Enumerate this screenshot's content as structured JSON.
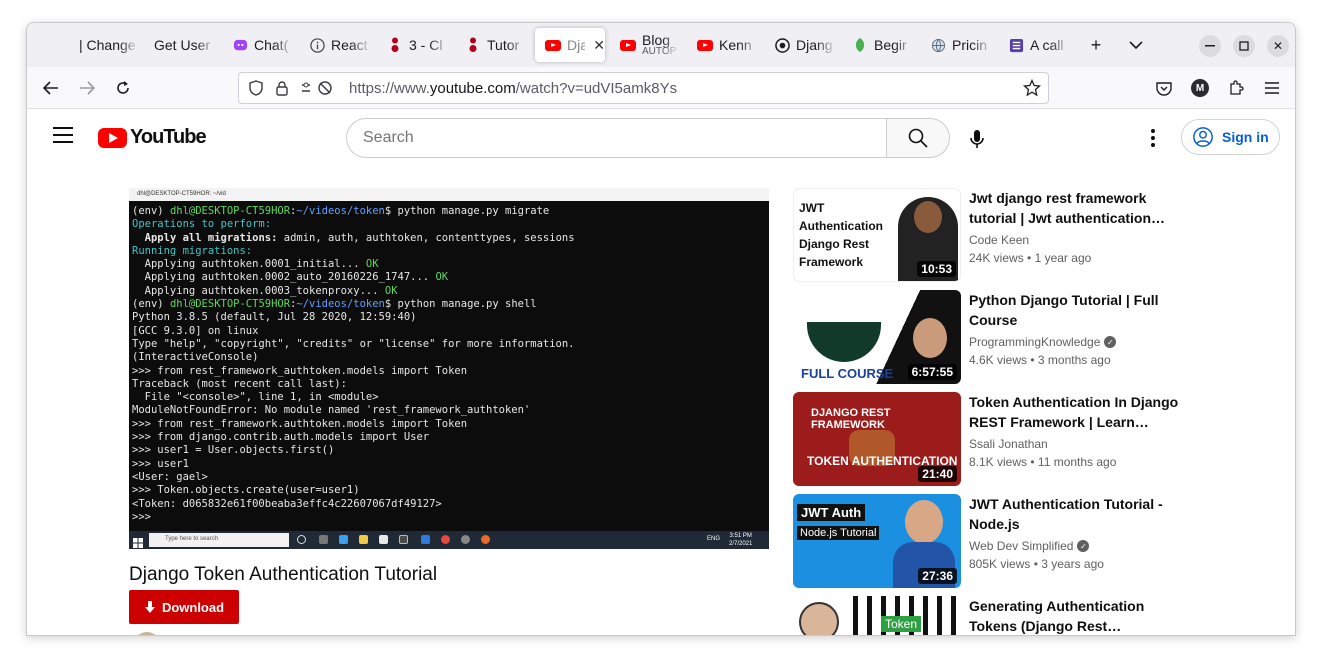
{
  "browser": {
    "tabs": [
      {
        "label": "| Change",
        "favicon": "none"
      },
      {
        "label": "Get User",
        "favicon": "none"
      },
      {
        "label": "Chat(",
        "favicon": "chat-icon"
      },
      {
        "label": "React",
        "favicon": "info-icon"
      },
      {
        "label": "3 - Cl",
        "favicon": "dots-icon"
      },
      {
        "label": "Tutor",
        "favicon": "dots-icon"
      },
      {
        "label": "Dja",
        "favicon": "youtube-icon",
        "active": true
      },
      {
        "label": "Blog",
        "sub": "AUTOP",
        "favicon": "youtube-icon"
      },
      {
        "label": "Kenn",
        "favicon": "youtube-icon"
      },
      {
        "label": "Djang",
        "favicon": "github-icon"
      },
      {
        "label": "Begir",
        "favicon": "leaf-icon"
      },
      {
        "label": "Pricin",
        "favicon": "globe-icon"
      },
      {
        "label": "A call",
        "favicon": "list-icon"
      }
    ],
    "url_prefix": "https://www.",
    "url_host": "youtube.com",
    "url_path": "/watch?v=udVI5amk8Ys",
    "profile_initial": "M"
  },
  "youtube": {
    "logo_text": "YouTube",
    "search_placeholder": "Search",
    "sign_in": "Sign in",
    "video_title": "Django Token Authentication Tutorial",
    "download_label": "Download",
    "terminal": {
      "window_title": "dhl@DESKTOP-CT59HOR: ~/vid",
      "taskbar_search": "Type here to search",
      "clock_time": "3:51 PM",
      "clock_date": "2/7/2021",
      "lang": "ENG"
    }
  },
  "related": [
    {
      "title": "Jwt django rest framework tutorial | Jwt authentication in...",
      "channel": "Code Keen",
      "verified": false,
      "views": "24K views",
      "age": "1 year ago",
      "duration": "10:53",
      "thumb_text": "JWT Authentication Django Rest Framework"
    },
    {
      "title": "Python Django Tutorial | Full Course",
      "channel": "ProgrammingKnowledge",
      "verified": true,
      "views": "4.6K views",
      "age": "3 months ago",
      "duration": "6:57:55",
      "thumb_text": "FULL COURSE"
    },
    {
      "title": "Token Authentication In Django REST Framework | Learn Djan...",
      "channel": "Ssali Jonathan",
      "verified": false,
      "views": "8.1K views",
      "age": "11 months ago",
      "duration": "21:40",
      "thumb_text": "DJANGO REST FRAMEWORK"
    },
    {
      "title": "JWT Authentication Tutorial - Node.js",
      "channel": "Web Dev Simplified",
      "verified": true,
      "views": "805K views",
      "age": "3 years ago",
      "duration": "27:36",
      "thumb_text": "JWT Auth"
    },
    {
      "title": "Generating Authentication Tokens (Django Rest framewo...",
      "channel": "",
      "verified": false,
      "views": "",
      "age": "",
      "duration": "",
      "thumb_text": "Token"
    }
  ],
  "colors": {
    "youtube_red": "#ff0000",
    "signin_blue": "#065fd4",
    "download_red": "#cc0000"
  }
}
